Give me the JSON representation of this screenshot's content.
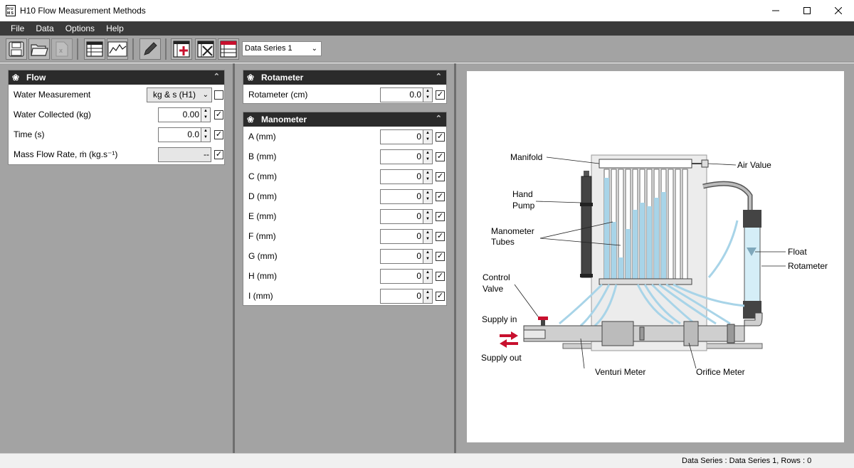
{
  "window": {
    "title": "H10 Flow Measurement Methods",
    "icon_text": "HUMS"
  },
  "menu": [
    "File",
    "Data",
    "Options",
    "Help"
  ],
  "toolbar": {
    "series_selected": "Data Series 1"
  },
  "flow": {
    "title": "Flow",
    "water_measurement_label": "Water Measurement",
    "water_measurement_value": "kg & s (H1)",
    "water_collected_label": "Water Collected (kg)",
    "water_collected_value": "0.00",
    "time_label": "Time  (s)",
    "time_value": "0.0",
    "mass_flow_label": "Mass Flow Rate, ṁ  (kg.s⁻¹)",
    "mass_flow_value": "--"
  },
  "rotameter": {
    "title": "Rotameter",
    "label": "Rotameter  (cm)",
    "value": "0.0"
  },
  "manometer": {
    "title": "Manometer",
    "rows": [
      {
        "label": "A  (mm)",
        "value": "0"
      },
      {
        "label": "B  (mm)",
        "value": "0"
      },
      {
        "label": "C  (mm)",
        "value": "0"
      },
      {
        "label": "D  (mm)",
        "value": "0"
      },
      {
        "label": "E  (mm)",
        "value": "0"
      },
      {
        "label": "F  (mm)",
        "value": "0"
      },
      {
        "label": "G  (mm)",
        "value": "0"
      },
      {
        "label": "H  (mm)",
        "value": "0"
      },
      {
        "label": "I  (mm)",
        "value": "0"
      }
    ]
  },
  "diagram": {
    "manifold": "Manifold",
    "air_value": "Air Value",
    "hand": "Hand",
    "pump": "Pump",
    "manometer": "Manometer",
    "tubes": "Tubes",
    "float": "Float",
    "rotameter": "Rotameter",
    "control": "Control",
    "valve": "Valve",
    "supply_in": "Supply in",
    "supply_out": "Supply out",
    "venturi": "Venturi Meter",
    "orifice": "Orifice Meter"
  },
  "status": {
    "text": "Data Series : Data Series 1,  Rows : 0"
  },
  "colors": {
    "accent_red": "#c8102e",
    "water_blue": "#a8d4e8",
    "panel_header": "#2b2b2b"
  }
}
